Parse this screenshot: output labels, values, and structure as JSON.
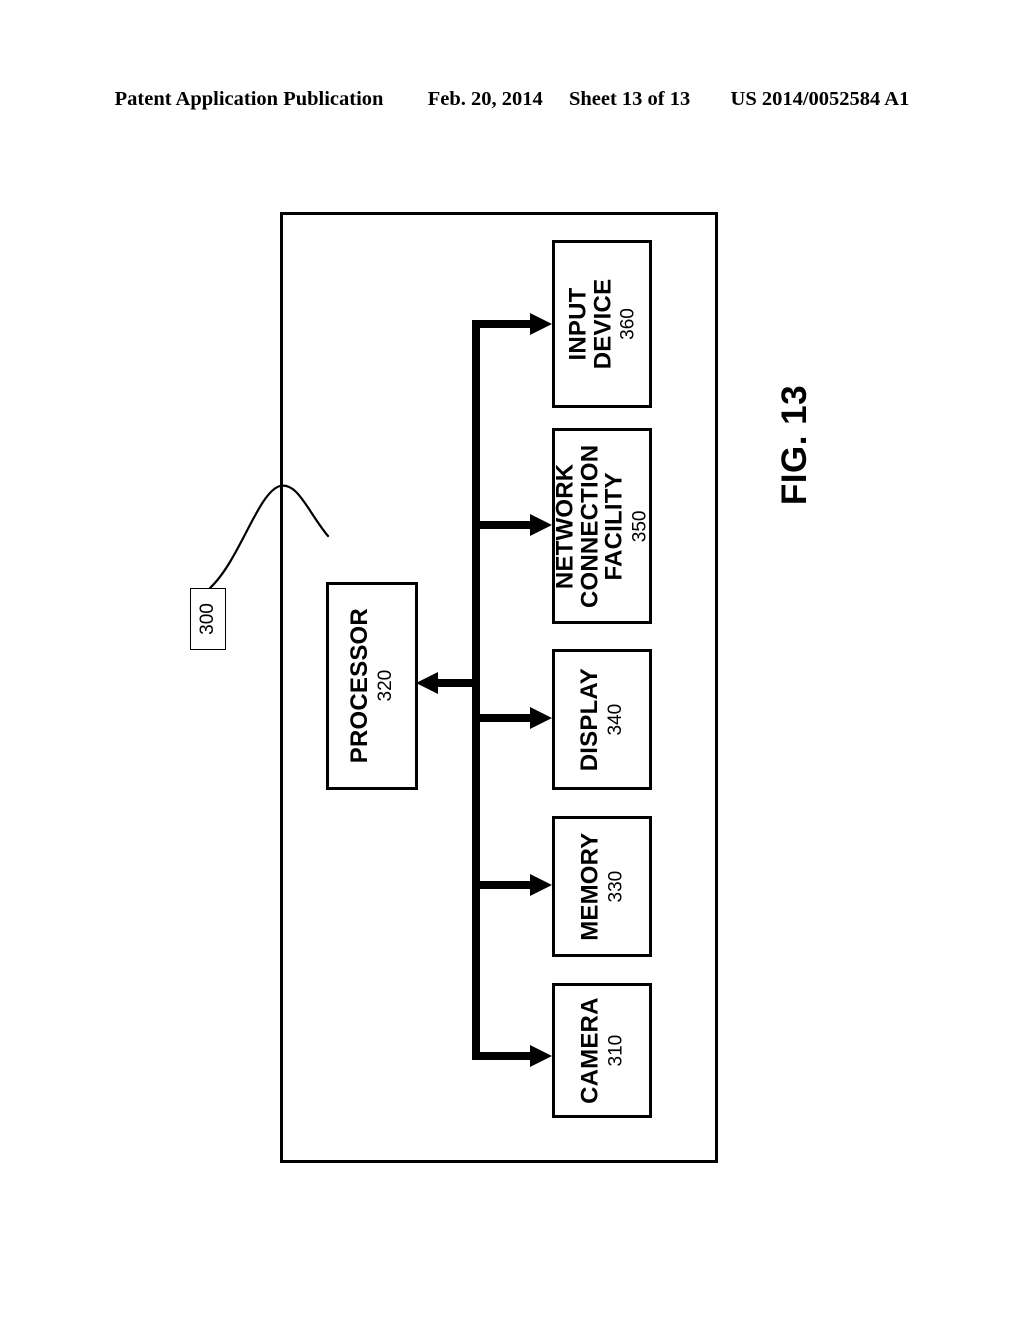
{
  "header": {
    "publication_label": "Patent Application Publication",
    "date": "Feb. 20, 2014",
    "sheet": "Sheet 13 of 13",
    "patent_number": "US 2014/0052584 A1"
  },
  "figure": {
    "caption": "FIG. 13",
    "apparatus_ref": "300"
  },
  "components": [
    {
      "id": "input-device",
      "lines": [
        "INPUT",
        "DEVICE"
      ],
      "title": "INPUT DEVICE",
      "number": "360"
    },
    {
      "id": "network-connection-facility",
      "lines": [
        "NETWORK",
        "CONNECTION",
        "FACILITY"
      ],
      "title": "NETWORK CONNECTION FACILITY",
      "number": "350"
    },
    {
      "id": "display",
      "lines": [
        "DISPLAY"
      ],
      "title": "DISPLAY",
      "number": "340"
    },
    {
      "id": "memory",
      "lines": [
        "MEMORY"
      ],
      "title": "MEMORY",
      "number": "330"
    },
    {
      "id": "camera",
      "lines": [
        "CAMERA"
      ],
      "title": "CAMERA",
      "number": "310"
    },
    {
      "id": "processor",
      "lines": [
        "PROCESSOR"
      ],
      "title": "PROCESSOR",
      "number": "320"
    }
  ],
  "colors": {
    "ink": "#000000",
    "paper": "#ffffff"
  }
}
